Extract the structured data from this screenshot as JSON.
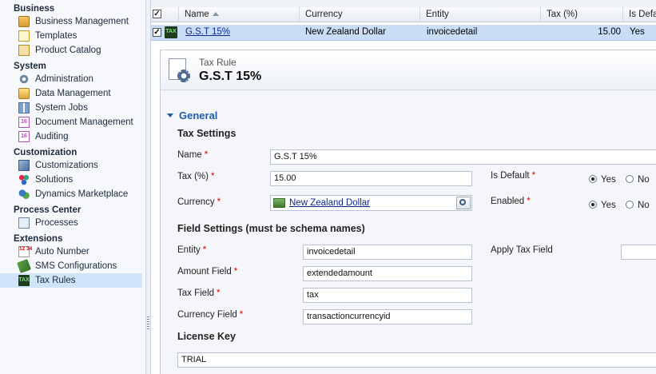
{
  "nav": {
    "groups": [
      {
        "title": "Business",
        "items": [
          {
            "label": "Business Management",
            "icon": "business-management-icon"
          },
          {
            "label": "Templates",
            "icon": "templates-icon"
          },
          {
            "label": "Product Catalog",
            "icon": "product-catalog-icon"
          }
        ]
      },
      {
        "title": "System",
        "items": [
          {
            "label": "Administration",
            "icon": "gear-icon"
          },
          {
            "label": "Data Management",
            "icon": "data-management-icon"
          },
          {
            "label": "System Jobs",
            "icon": "system-jobs-icon"
          },
          {
            "label": "Document Management",
            "icon": "calendar-icon"
          },
          {
            "label": "Auditing",
            "icon": "calendar-icon"
          }
        ]
      },
      {
        "title": "Customization",
        "items": [
          {
            "label": "Customizations",
            "icon": "customizations-icon"
          },
          {
            "label": "Solutions",
            "icon": "solutions-icon"
          },
          {
            "label": "Dynamics Marketplace",
            "icon": "marketplace-icon"
          }
        ]
      },
      {
        "title": "Process Center",
        "items": [
          {
            "label": "Processes",
            "icon": "processes-icon"
          }
        ]
      },
      {
        "title": "Extensions",
        "items": [
          {
            "label": "Auto Number",
            "icon": "auto-number-icon"
          },
          {
            "label": "SMS Configurations",
            "icon": "sms-icon"
          },
          {
            "label": "Tax Rules",
            "icon": "tax-icon",
            "selected": true
          }
        ]
      }
    ],
    "calendar_glyph": "16",
    "auto_number_glyph": "12 34",
    "tax_glyph": "TAX"
  },
  "grid": {
    "columns": [
      "Name",
      "Currency",
      "Entity",
      "Tax (%)",
      "Is Defa"
    ],
    "rows": [
      {
        "checked": true,
        "name": "G.S.T 15%",
        "currency": "New Zealand Dollar",
        "entity": "invoicedetail",
        "tax": "15.00",
        "is_default": "Yes"
      }
    ],
    "check_glyph": "✓"
  },
  "form": {
    "entity_type": "Tax Rule",
    "record_title": "G.S.T 15%",
    "section": "General",
    "tax_settings": {
      "heading": "Tax Settings",
      "name_label": "Name",
      "name_value": "G.S.T 15%",
      "tax_label": "Tax (%)",
      "tax_value": "15.00",
      "currency_label": "Currency",
      "currency_value": "New Zealand Dollar",
      "is_default_label": "Is Default",
      "enabled_label": "Enabled",
      "yes": "Yes",
      "no": "No",
      "is_default": "Yes",
      "enabled": "Yes"
    },
    "field_settings": {
      "heading": "Field Settings (must be schema names)",
      "entity_label": "Entity",
      "entity_value": "invoicedetail",
      "amount_label": "Amount Field",
      "amount_value": "extendedamount",
      "tax_field_label": "Tax Field",
      "tax_field_value": "tax",
      "currency_field_label": "Currency Field",
      "currency_field_value": "transactioncurrencyid",
      "apply_tax_label": "Apply Tax Field",
      "apply_tax_value": ""
    },
    "license": {
      "heading": "License Key",
      "value": "TRIAL"
    },
    "required_mark": "*"
  }
}
